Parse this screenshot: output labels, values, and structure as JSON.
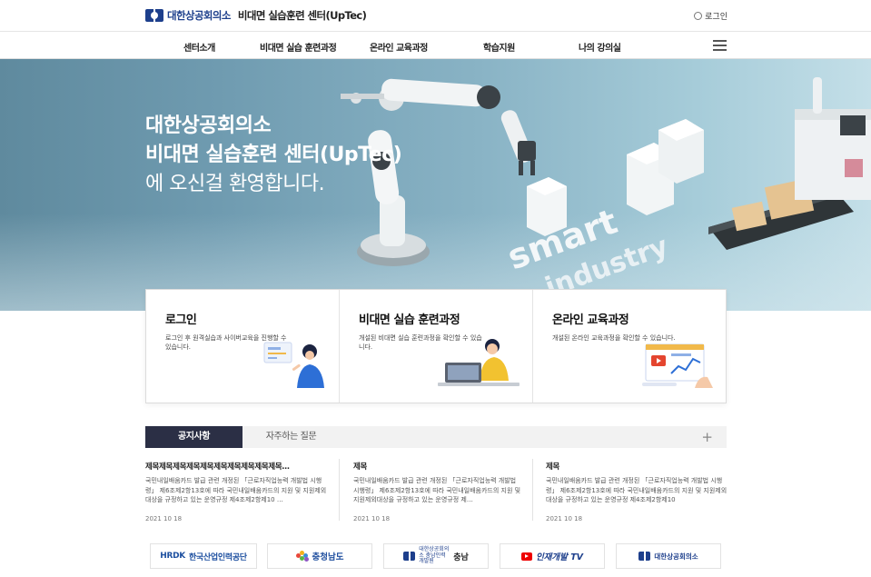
{
  "header": {
    "org": "대한상공회의소",
    "title": "비대면 실습훈련 센터(UpTec)",
    "login_label": "로그인"
  },
  "nav": {
    "items": [
      "센터소개",
      "비대면 실습 훈련과정",
      "온라인 교육과정",
      "학습지원",
      "나의 강의실"
    ]
  },
  "hero": {
    "line1": "대한상공회의소",
    "line2": "비대면 실습훈련 센터(UpTec)",
    "line3": "에 오신걸 환영합니다.",
    "art_text1": "smart",
    "art_text2": "industry"
  },
  "cards": [
    {
      "title": "로그인",
      "desc": "로그인 후 원격실습과 사이버교육을 진행할 수 있습니다."
    },
    {
      "title": "비대면 실습 훈련과정",
      "desc": "개설된 비대면 실습 훈련과정을 확인할 수 있습니다."
    },
    {
      "title": "온라인 교육과정",
      "desc": "개설된 온라인 교육과정을 확인할 수 있습니다."
    }
  ],
  "tabs": {
    "items": [
      "공지사항",
      "자주하는 질문"
    ],
    "active": "공지사항",
    "more": "+"
  },
  "notices": [
    {
      "title": "제목제목제목제목제목제목제목제목제목제목…",
      "body": "국민내일배움카드 발급 관련 개정된 「근로자직업능력 개발법 시행령」 제6조제2항13호에 따라 국민내일배움카드의 지원 및 지원제외대상을 규정하고 있는 운영규정 제4조제2항제10 …",
      "date": "2021 10 18"
    },
    {
      "title": "제목",
      "body": "국민내일배움카드 발급 관련 개정된 「근로자직업능력 개발법 시행령」 제6조제2항13호에 따라 국민내일배움카드의 지원 및 지원제외대상을 규정하고 있는 운영규정 제…",
      "date": "2021 10 18"
    },
    {
      "title": "제목",
      "body": "국민내일배움카드 발급 관련 개정된 「근로자직업능력 개발법 시행령」 제6조제2항13호에 따라 국민내일배움카드의 지원 및 지원제외대상을 규정하고 있는 운영규정 제4조제2항제10",
      "date": "2021 10 18"
    }
  ],
  "partners": {
    "hrdk_logo": "HRDK",
    "hrdk_name": "한국산업인력공단",
    "chungnam": "충청남도",
    "kcci_chungnam_small": "대한상공회의소 충남인력개발원",
    "kcci_chungnam": "충남",
    "tv": "인재개발 TV",
    "kcci": "대한상공회의소"
  },
  "colors": {
    "brand": "#1d3f8c",
    "tab_active": "#2b2f45",
    "hero_start": "#5f8a9e",
    "hero_end": "#c4dfe8"
  }
}
